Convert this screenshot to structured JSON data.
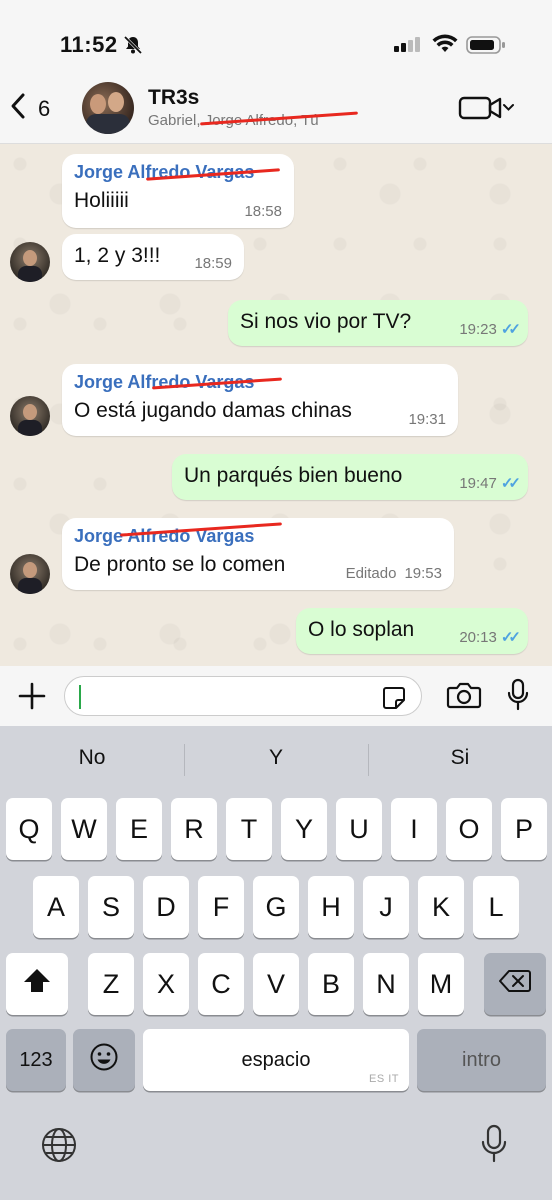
{
  "status_bar": {
    "time": "11:52"
  },
  "header": {
    "back_count": "6",
    "group_name": "TR3s",
    "members": "Gabriel, Jorge Alfredo, Tú"
  },
  "messages": [
    {
      "sender": "Jorge Alfredo Vargas",
      "text": "Holiiiii",
      "time": "18:58"
    },
    {
      "text": "1, 2 y 3!!!",
      "time": "18:59"
    },
    {
      "text": "Si nos vio por TV?",
      "time": "19:23"
    },
    {
      "sender": "Jorge Alfredo Vargas",
      "text": "O está jugando damas chinas",
      "time": "19:31"
    },
    {
      "text": "Un parqués bien bueno",
      "time": "19:47"
    },
    {
      "sender": "Jorge Alfredo Vargas",
      "text": "De pronto se lo comen",
      "edited": "Editado",
      "time": "19:53"
    },
    {
      "text": "O lo soplan",
      "time": "20:13"
    }
  ],
  "input": {
    "placeholder": ""
  },
  "keyboard": {
    "suggestions": [
      "No",
      "Y",
      "Si"
    ],
    "row1": [
      "Q",
      "W",
      "E",
      "R",
      "T",
      "Y",
      "U",
      "I",
      "O",
      "P"
    ],
    "row2": [
      "A",
      "S",
      "D",
      "F",
      "G",
      "H",
      "J",
      "K",
      "L"
    ],
    "row3": [
      "Z",
      "X",
      "C",
      "V",
      "B",
      "N",
      "M"
    ],
    "numbers_key": "123",
    "space_key": "espacio",
    "space_layout_hint": "ES IT",
    "return_key": "intro"
  },
  "colors": {
    "sender_name": "#3a6fbd",
    "outgoing_bubble": "#d9fdd3",
    "read_ticks": "#4fa3e0",
    "redaction": "#e8281f"
  }
}
